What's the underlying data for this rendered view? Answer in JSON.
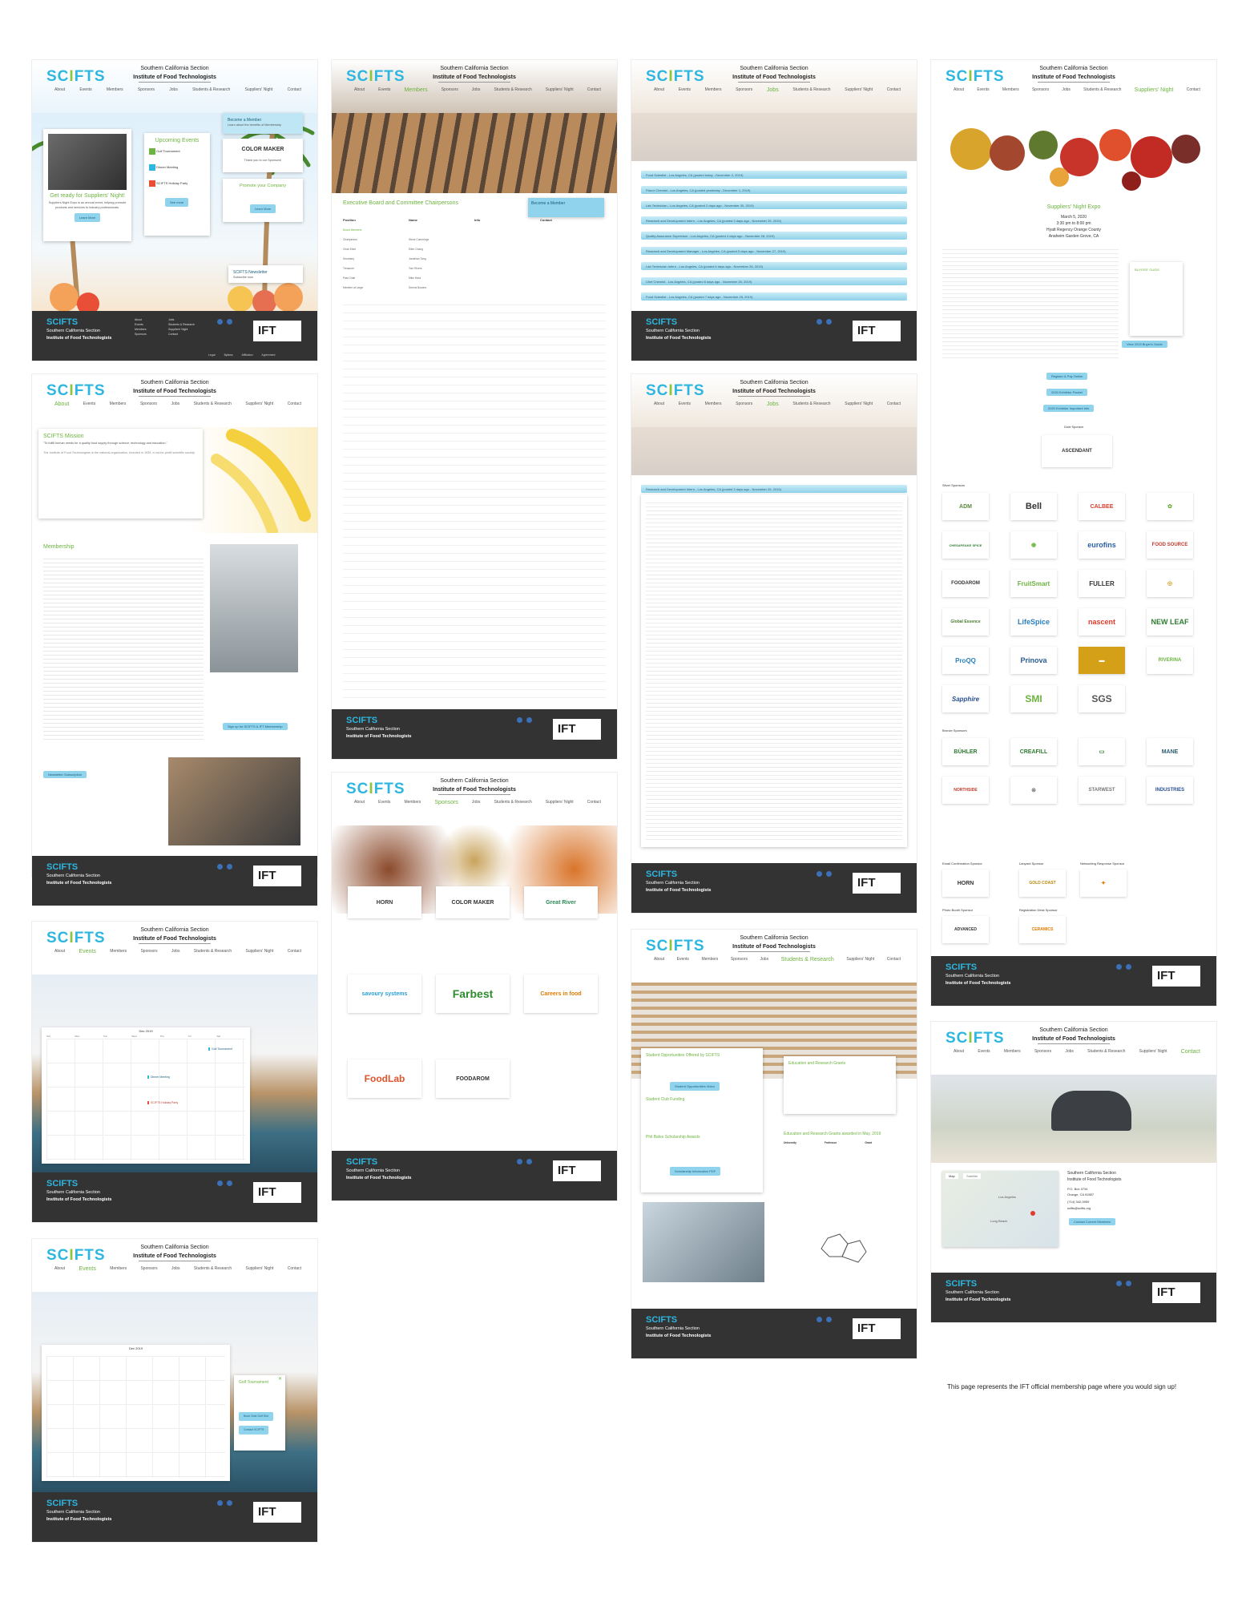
{
  "brand": {
    "logo_left": "SC",
    "logo_mid": "I",
    "logo_right": "FTS",
    "section": "Southern California Section",
    "institute": "Institute of Food Technologists",
    "ift": "IFT"
  },
  "nav": [
    "About",
    "Events",
    "Members",
    "Sponsors",
    "Jobs",
    "Students & Research",
    "Suppliers' Night",
    "Contact"
  ],
  "footer": {
    "links": [
      "About",
      "Events",
      "Members",
      "Sponsors",
      "Jobs",
      "Students & Research",
      "Suppliers' Night",
      "Contact"
    ],
    "bottom": [
      "Legal",
      "Bylaws",
      "Affiliation Agreement"
    ]
  },
  "home": {
    "card_title": "Get ready for Suppliers' Night!",
    "card_text": "Suppliers Night Expo is an annual event, helping promote products and services to industry professionals.",
    "card_btn": "Learn More",
    "events_title": "Upcoming Events",
    "events": [
      "Golf Tournament",
      "Dinner Meeting",
      "SCIFTS Holiday Party"
    ],
    "events_btn": "See more",
    "member_title": "Become a Member",
    "member_text": "Learn about the benefits of Membership",
    "sponsor_name": "COLOR MAKER",
    "sponsor_thanks": "Thank you to our Sponsors!",
    "promote_title": "Promote your Company",
    "promote_btn": "Learn More",
    "newsletter_title": "SCIFTS Newsletter",
    "newsletter_btn": "Subscribe now"
  },
  "about": {
    "mission_title": "SCIFTS Mission",
    "mission_quote": "\"To fulfill human needs for a quality food supply through science, technology and education.\"",
    "membership_title": "Membership",
    "signup_btn": "Sign up for SCIFTS & IFT Membership",
    "newsletter_btn": "Newsletter Subscription"
  },
  "board": {
    "title": "Executive Board and Committee Chairpersons",
    "member_btn": "Become a Member",
    "headers": [
      "Position",
      "Name",
      "Info",
      "Contact"
    ],
    "subhead": "Board Members",
    "rows": [
      [
        "Chairperson",
        "Steve Cummings",
        "",
        ""
      ],
      [
        "Chair Elect",
        "Ellen Chang",
        "",
        ""
      ],
      [
        "Secretary",
        "Jonathan Tang",
        "",
        ""
      ],
      [
        "Treasurer",
        "Tom Rivers",
        "",
        ""
      ],
      [
        "Past Chair",
        "Mike Hara",
        "",
        ""
      ],
      [
        "Member at Large",
        "Dennis Bowers",
        "",
        ""
      ]
    ]
  },
  "jobs": {
    "items": [
      "Food Scientist - Los Angeles, CA (posted today - December 2, 2019)",
      "Flavor Chemist - Los Angeles, CA (posted yesterday - December 1, 2019)",
      "Lab Technician - Los Angeles, CA (posted 2 days ago - November 30, 2019)",
      "Research and Development Intern - Los Angeles, CA (posted 3 days ago - November 29, 2019)",
      "Quality Assurance Supervisor - Los Angeles, CA (posted 4 days ago - November 28, 2019)",
      "Research and Development Manager - Los Angeles, CA (posted 5 days ago - November 27, 2019)",
      "Lab Technician Intern - Los Angeles, CA (posted 6 days ago - November 26, 2019)",
      "Chef Chemist - Los Angeles, CA (posted 6 days ago - November 26, 2019)",
      "Food Scientist - Los Angeles, CA (posted 7 days ago - November 25, 2019)"
    ],
    "detail_title": "Research and Development Intern - Los Angeles, CA (posted 3 days ago - November 29, 2019)"
  },
  "sponsors": {
    "cards": [
      {
        "name": "HORN",
        "color": "#3a3a3a"
      },
      {
        "name": "COLOR MAKER",
        "color": "#333333"
      },
      {
        "name": "Great River",
        "color": "#2e8b57"
      },
      {
        "name": "savoury systems",
        "color": "#2a9fd6"
      },
      {
        "name": "Farbest",
        "color": "#2e8b2e"
      },
      {
        "name": "Careers in food",
        "color": "#e07b00"
      },
      {
        "name": "FoodLab",
        "color": "#e2532b"
      },
      {
        "name": "FOODAROM",
        "color": "#222222"
      }
    ]
  },
  "students": {
    "opp_title": "Student Opportunities Offered by SCIFTS",
    "opp_btn": "Student Opportunities Video",
    "club_title": "Student Club Funding",
    "phil_title": "Phil Bales Scholarship Awards",
    "phil_btn": "Scholarship Information PDF",
    "edu_title": "Education and Research Grants",
    "edu2_title": "Education and Research Grants awarded in May, 2019",
    "edu_headers": [
      "University",
      "Professor",
      "Grant"
    ]
  },
  "calendar": {
    "month": "Dec 2019",
    "days": [
      "Sun",
      "Mon",
      "Tue",
      "Wed",
      "Thu",
      "Fri",
      "Sat"
    ],
    "events": [
      "Golf Tournament",
      "Dinner Meeting",
      "SCIFTS Holiday Party"
    ],
    "popup_title": "Golf Tournament",
    "popup_btn1": "Book Gold Golf Slot",
    "popup_btn2": "Contact SCIFTS"
  },
  "suppliers": {
    "title": "Suppliers' Night Expo",
    "date": "March 5, 2020",
    "time": "3:30 pm to 8:00 pm",
    "venue": "Hyatt Regency Orange County",
    "city": "Anaheim Garden Grove, CA",
    "btns": [
      "Register & Pay Online",
      "2020 Exhibitor Packet",
      "2020 Exhibitor Important Info"
    ],
    "buyers_btn": "View 2019 Buyer's Guide",
    "gold_label": "Gold Sponsor",
    "gold_name": "ASCENDANT",
    "silver_label": "Silver Sponsors",
    "silver": [
      "ADM",
      "Bell",
      "CALBEE",
      "",
      "CHESAPEAKE SPICE",
      "",
      "eurofins",
      "FOOD SOURCE",
      "FOODAROM",
      "FruitSmart",
      "FULLER",
      "",
      "Global Essence",
      "LifeSpice",
      "nascent",
      "NEW LEAF",
      "ProQQ",
      "Prinova",
      "",
      "RIVERINA",
      "Sapphire",
      "SMI",
      "SGS",
      ""
    ],
    "bronze_label": "Bronze Sponsors",
    "bronze": [
      "BÜHLER",
      "CREAFILL",
      "",
      "MANE",
      "NORTHSIDE",
      "",
      "STARWEST",
      "INDUSTRIES"
    ],
    "email_label": "Email Confirmation Sponsor",
    "lanyard_label": "Lanyard Sponsor",
    "network_label": "Networking Response Sponsor",
    "photo_label": "Photo Booth Sponsor",
    "reg_label": "Registration Desk Sponsor",
    "special": [
      "HORN",
      "GOLD COAST",
      "",
      "ADVANCED",
      "CERAMICS"
    ]
  },
  "contact": {
    "name": "Southern California Section",
    "inst": "Institute of Food Technologists",
    "box": "P.O. Box 3734",
    "city": "Orange, CA 92857",
    "phone": "(714) 342-0959",
    "email": "scifts@scifts.org",
    "btn": "Contact Current Members",
    "map_tab1": "Map",
    "map_tab2": "Satellite",
    "map_city1": "Los Angeles",
    "map_city2": "Long Beach"
  },
  "caption": "This page represents the IFT official membership page where you would sign up!",
  "colors": {
    "accent": "#2db6e0",
    "green": "#6cb33f",
    "footer": "#333333"
  }
}
